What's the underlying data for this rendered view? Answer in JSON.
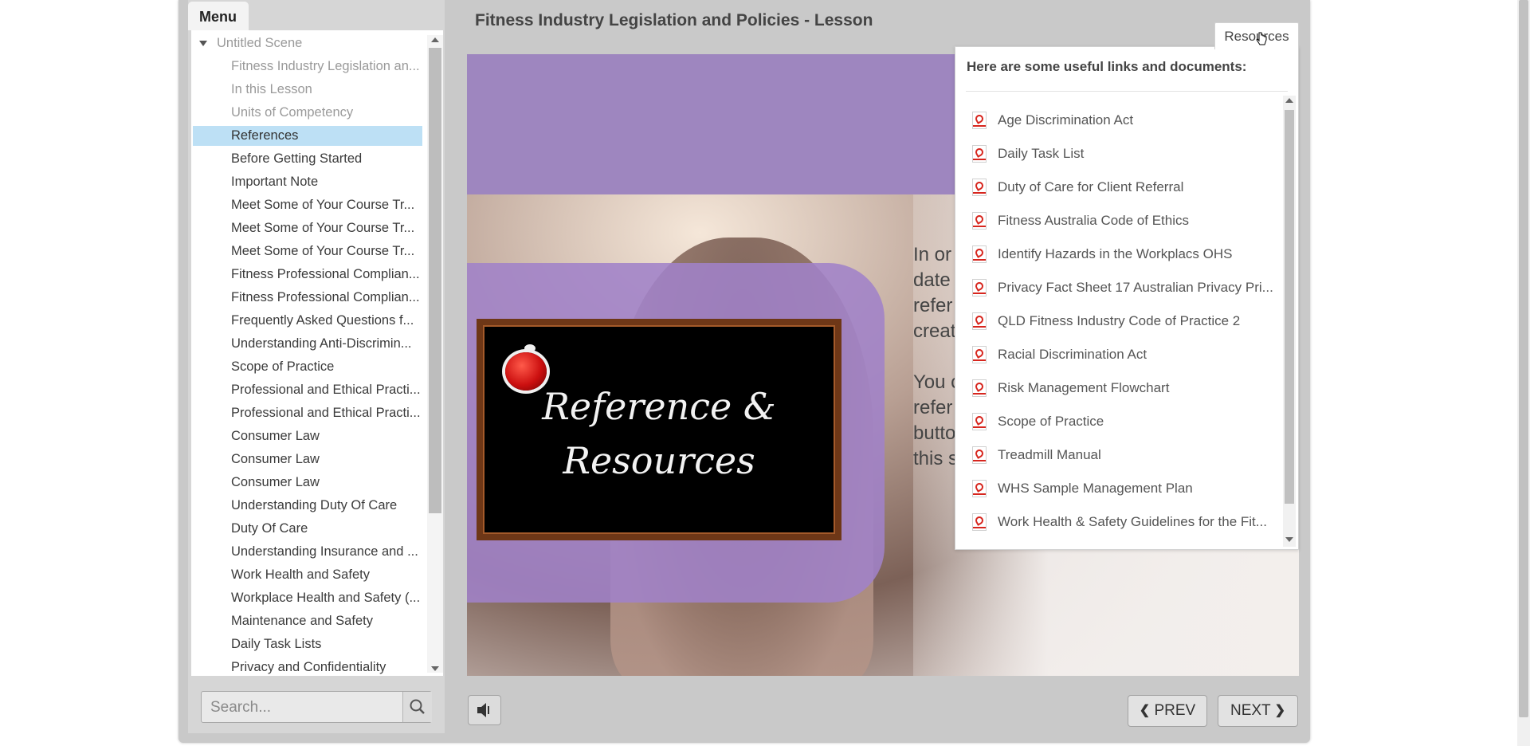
{
  "sidebar": {
    "menu_label": "Menu",
    "scene": "Untitled Scene",
    "items": [
      {
        "label": "Fitness Industry Legislation an...",
        "state": "visited"
      },
      {
        "label": "In this Lesson",
        "state": "visited"
      },
      {
        "label": "Units of Competency",
        "state": "visited"
      },
      {
        "label": "References",
        "state": "selected"
      },
      {
        "label": "Before Getting Started",
        "state": "normal"
      },
      {
        "label": "Important Note",
        "state": "normal"
      },
      {
        "label": "Meet Some of Your Course Tr...",
        "state": "normal"
      },
      {
        "label": "Meet Some of Your Course Tr...",
        "state": "normal"
      },
      {
        "label": "Meet Some of Your Course Tr...",
        "state": "normal"
      },
      {
        "label": "Fitness Professional Complian...",
        "state": "normal"
      },
      {
        "label": "Fitness Professional Complian...",
        "state": "normal"
      },
      {
        "label": "Frequently Asked Questions f...",
        "state": "normal"
      },
      {
        "label": "Understanding Anti-Discrimin...",
        "state": "normal"
      },
      {
        "label": "Scope of Practice",
        "state": "normal"
      },
      {
        "label": "Professional and Ethical Practi...",
        "state": "normal"
      },
      {
        "label": "Professional and Ethical Practi...",
        "state": "normal"
      },
      {
        "label": "Consumer Law",
        "state": "normal"
      },
      {
        "label": "Consumer Law",
        "state": "normal"
      },
      {
        "label": "Consumer Law",
        "state": "normal"
      },
      {
        "label": "Understanding Duty Of Care",
        "state": "normal"
      },
      {
        "label": "Duty Of Care",
        "state": "normal"
      },
      {
        "label": "Understanding Insurance and ...",
        "state": "normal"
      },
      {
        "label": "Work Health and Safety",
        "state": "normal"
      },
      {
        "label": "Workplace Health and Safety (...",
        "state": "normal"
      },
      {
        "label": "Maintenance and Safety",
        "state": "normal"
      },
      {
        "label": "Daily Task Lists",
        "state": "normal"
      },
      {
        "label": "Privacy and Confidentiality",
        "state": "normal"
      }
    ],
    "search": {
      "placeholder": "Search...",
      "value": "",
      "icon": "search-icon"
    }
  },
  "main": {
    "title": "Fitness Industry Legislation and Policies - Lesson",
    "slide": {
      "chalkboard_line1": "Reference &",
      "chalkboard_line2": "Resources",
      "text_lines": [
        "In or",
        "date",
        "refer",
        "creat",
        "You c",
        "refer",
        "butto",
        "this s"
      ]
    },
    "controls": {
      "mute_icon": "speaker-icon",
      "prev_label": "PREV",
      "next_label": "NEXT"
    }
  },
  "resources": {
    "tab_label": "Resources",
    "heading": "Here are some useful links and documents:",
    "items": [
      "Age Discrimination Act",
      "Daily Task List",
      "Duty of Care for Client Referral",
      "Fitness Australia Code of Ethics",
      "Identify Hazards in the Workplacs OHS",
      "Privacy Fact Sheet 17 Australian Privacy Pri...",
      "QLD Fitness Industry Code of Practice 2",
      "Racial Discrimination Act",
      "Risk Management Flowchart",
      "Scope of Practice",
      "Treadmill Manual",
      "WHS Sample Management Plan",
      "Work Health & Safety Guidelines for the Fit...",
      ""
    ],
    "item_icon": "pdf-icon"
  },
  "colors": {
    "selected_row": "#bde0f5",
    "slide_purple": "#9e86bf",
    "pdf_red": "#d7261e"
  }
}
